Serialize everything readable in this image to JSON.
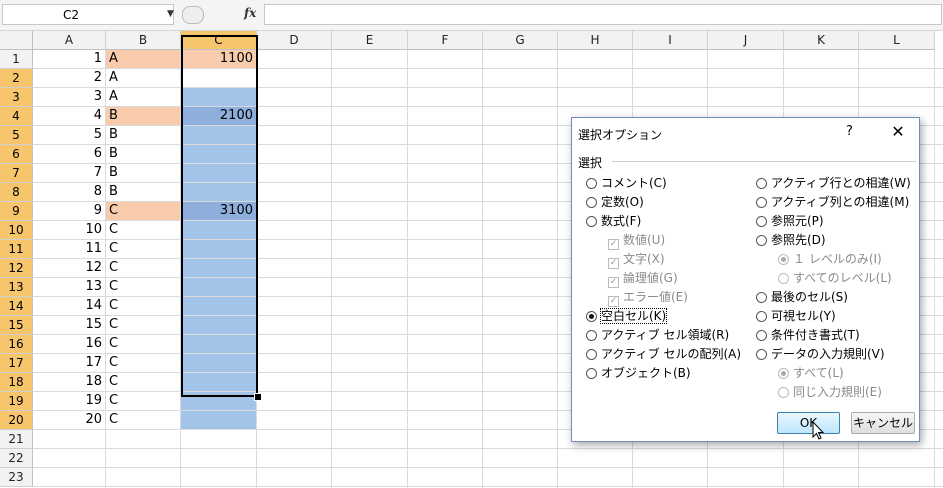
{
  "formula_bar": {
    "name_box": "C2",
    "fx": "fx"
  },
  "columns": [
    "A",
    "B",
    "C",
    "D",
    "E",
    "F",
    "G",
    "H",
    "I",
    "J",
    "K",
    "L"
  ],
  "rows": [
    "1",
    "2",
    "3",
    "4",
    "5",
    "6",
    "7",
    "8",
    "9",
    "10",
    "11",
    "12",
    "13",
    "14",
    "15",
    "16",
    "17",
    "18",
    "19",
    "20",
    "21",
    "22",
    "23"
  ],
  "cells": {
    "A": [
      "1",
      "2",
      "3",
      "4",
      "5",
      "6",
      "7",
      "8",
      "9",
      "10",
      "11",
      "12",
      "13",
      "14",
      "15",
      "16",
      "17",
      "18",
      "19",
      "20"
    ],
    "B": [
      "A",
      "A",
      "A",
      "B",
      "B",
      "B",
      "B",
      "B",
      "C",
      "C",
      "C",
      "C",
      "C",
      "C",
      "C",
      "C",
      "C",
      "C",
      "C",
      "C"
    ],
    "C": {
      "1": "1100",
      "4": "2100",
      "9": "3100"
    }
  },
  "dialog": {
    "title": "選択オプション",
    "help": "?",
    "close": "✕",
    "group_label": "選択",
    "left_options": [
      {
        "label": "コメント(C)",
        "state": "off"
      },
      {
        "label": "定数(O)",
        "state": "off"
      },
      {
        "label": "数式(F)",
        "state": "off"
      },
      {
        "label": "数値(U)",
        "state": "sub-check"
      },
      {
        "label": "文字(X)",
        "state": "sub-check"
      },
      {
        "label": "論理値(G)",
        "state": "sub-check"
      },
      {
        "label": "エラー値(E)",
        "state": "sub-check"
      },
      {
        "label": "空白セル(K)",
        "state": "on"
      },
      {
        "label": "アクティブ セル領域(R)",
        "state": "off"
      },
      {
        "label": "アクティブ セルの配列(A)",
        "state": "off"
      },
      {
        "label": "オブジェクト(B)",
        "state": "off"
      }
    ],
    "right_options": [
      {
        "label": "アクティブ行との相違(W)",
        "state": "off"
      },
      {
        "label": "アクティブ列との相違(M)",
        "state": "off"
      },
      {
        "label": "参照元(P)",
        "state": "off"
      },
      {
        "label": "参照先(D)",
        "state": "off"
      },
      {
        "label": "１ レベルのみ(I)",
        "state": "sub-on"
      },
      {
        "label": "すべてのレベル(L)",
        "state": "sub-off"
      },
      {
        "label": "最後のセル(S)",
        "state": "off"
      },
      {
        "label": "可視セル(Y)",
        "state": "off"
      },
      {
        "label": "条件付き書式(T)",
        "state": "off"
      },
      {
        "label": "データの入力規則(V)",
        "state": "off"
      },
      {
        "label": "すべて(L)",
        "state": "sub-on"
      },
      {
        "label": "同じ入力規則(E)",
        "state": "sub-off"
      }
    ],
    "ok": "OK",
    "cancel": "キャンセル"
  }
}
